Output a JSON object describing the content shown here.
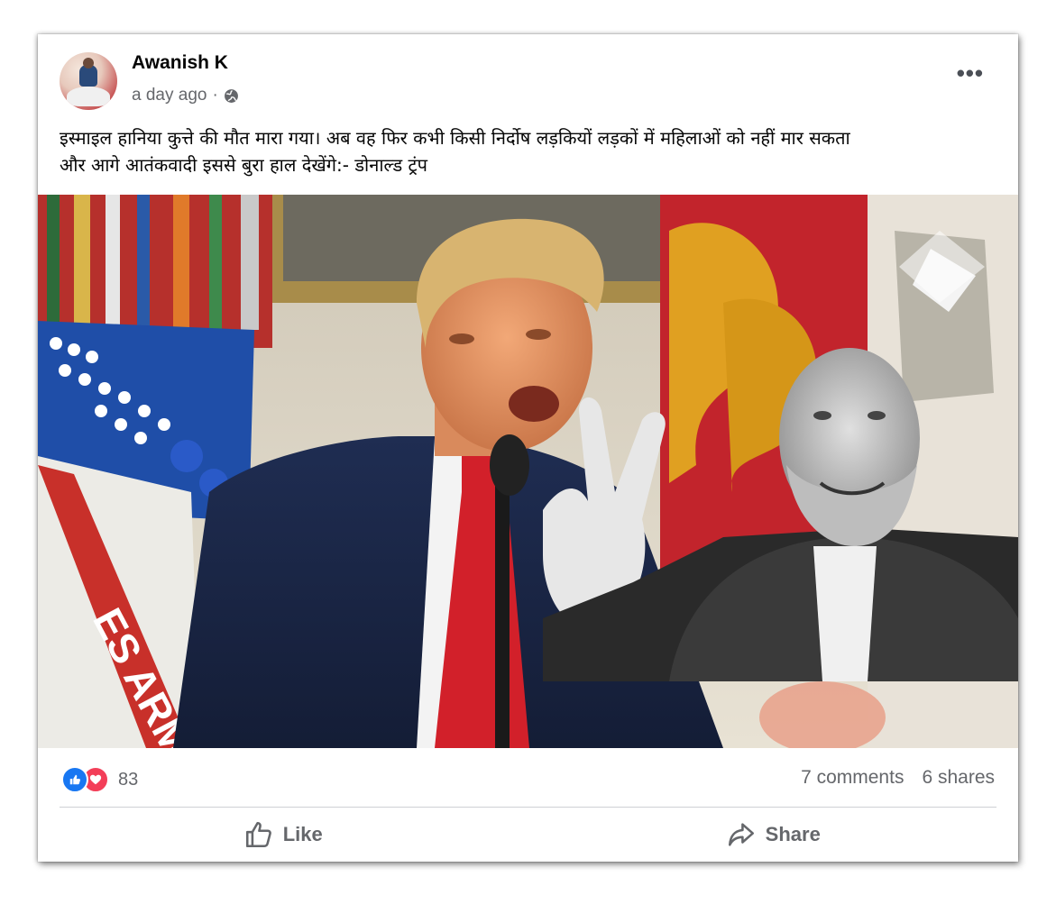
{
  "post": {
    "author": "Awanish K",
    "timestamp": "a day ago",
    "separator": "·",
    "privacy_icon": "globe-icon",
    "more_label": "•••",
    "caption_line1": "इस्माइल हानिया कुत्ते की मौत मारा गया। अब वह फिर कभी किसी निर्दोष लड़कियों लड़कों में महिलाओं को नहीं मार सकता",
    "caption_line2": "और आगे आतंकवादी इससे बुरा हाल देखेंगे:-  डोनाल्ड ट्रंप"
  },
  "media": {
    "flag_text": "ES ARM"
  },
  "stats": {
    "reaction_icons": [
      "like-icon",
      "love-icon"
    ],
    "reaction_count": "83",
    "comments": "7 comments",
    "shares": "6 shares"
  },
  "actions": {
    "like_label": "Like",
    "share_label": "Share"
  },
  "colors": {
    "like_blue": "#1877f2",
    "love_red": "#f33e58",
    "secondary_text": "#65676b"
  }
}
